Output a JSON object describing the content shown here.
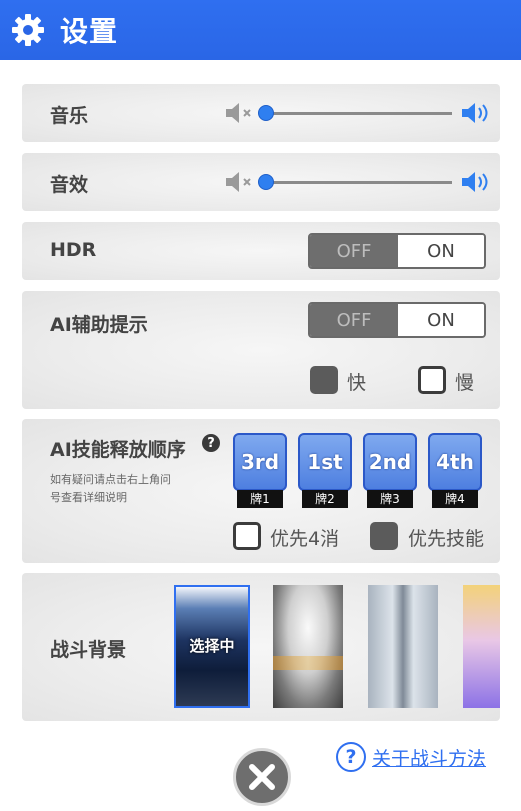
{
  "header": {
    "title": "设置",
    "icon": "gear-icon"
  },
  "music": {
    "label": "音乐",
    "value": 0.0
  },
  "sfx": {
    "label": "音效",
    "value": 0.0
  },
  "hdr": {
    "label": "HDR",
    "off_label": "OFF",
    "on_label": "ON",
    "state": "ON"
  },
  "ai_hint": {
    "label": "AI辅助提示",
    "off_label": "OFF",
    "on_label": "ON",
    "state": "ON",
    "speed_fast": "快",
    "speed_slow": "慢",
    "fast_checked": true,
    "slow_checked": false
  },
  "ai_skill": {
    "label": "AI技能释放顺序",
    "help_glyph": "?",
    "note_line1": "如有疑问请点击右上角问",
    "note_line2": "号查看详细说明",
    "cards": [
      {
        "rank": "3rd",
        "tag": "牌1"
      },
      {
        "rank": "1st",
        "tag": "牌2"
      },
      {
        "rank": "2nd",
        "tag": "牌3"
      },
      {
        "rank": "4th",
        "tag": "牌4"
      }
    ],
    "priority_clear": "优先4消",
    "priority_skill": "优先技能",
    "priority_clear_checked": false,
    "priority_skill_checked": true
  },
  "battle_bg": {
    "label": "战斗背景",
    "selected_label": "选择中",
    "selected_index": 0
  },
  "footer": {
    "help_glyph": "?",
    "help_link": "关于战斗方法",
    "close_icon": "close-icon"
  },
  "colors": {
    "accent": "#2f6ff0",
    "header": "#2a66e6",
    "toggle_off": "#6e6e6e"
  }
}
